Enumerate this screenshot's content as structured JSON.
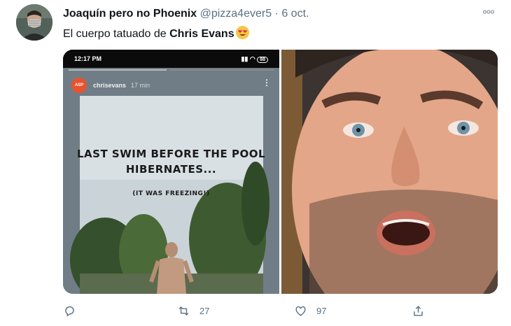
{
  "tweet": {
    "author_name": "Joaquín pero no Phoenix",
    "handle": "@pizza4ever5",
    "separator": "·",
    "date": "6 oct.",
    "text_prefix": "El cuerpo tatuado de ",
    "text_bold": "Chris Evans",
    "emoji": "heart-eyes-emoji",
    "more_icon": "more-icon"
  },
  "story": {
    "status_time": "12:17 PM",
    "battery": "88",
    "avatar_label": "ASP",
    "username": "chrisevans",
    "time_ago": "17 min",
    "caption_line1": "LAST SWIM BEFORE THE POOL",
    "caption_line2": "HIBERNATES...",
    "caption_line3": "(IT WAS FREEZING!)"
  },
  "actions": {
    "reply_icon": "reply-icon",
    "retweet_count": "27",
    "like_count": "97",
    "share_icon": "share-icon"
  },
  "colors": {
    "text_primary": "#0f1419",
    "text_secondary": "#5b7083",
    "story_badge": "#e9522e"
  }
}
